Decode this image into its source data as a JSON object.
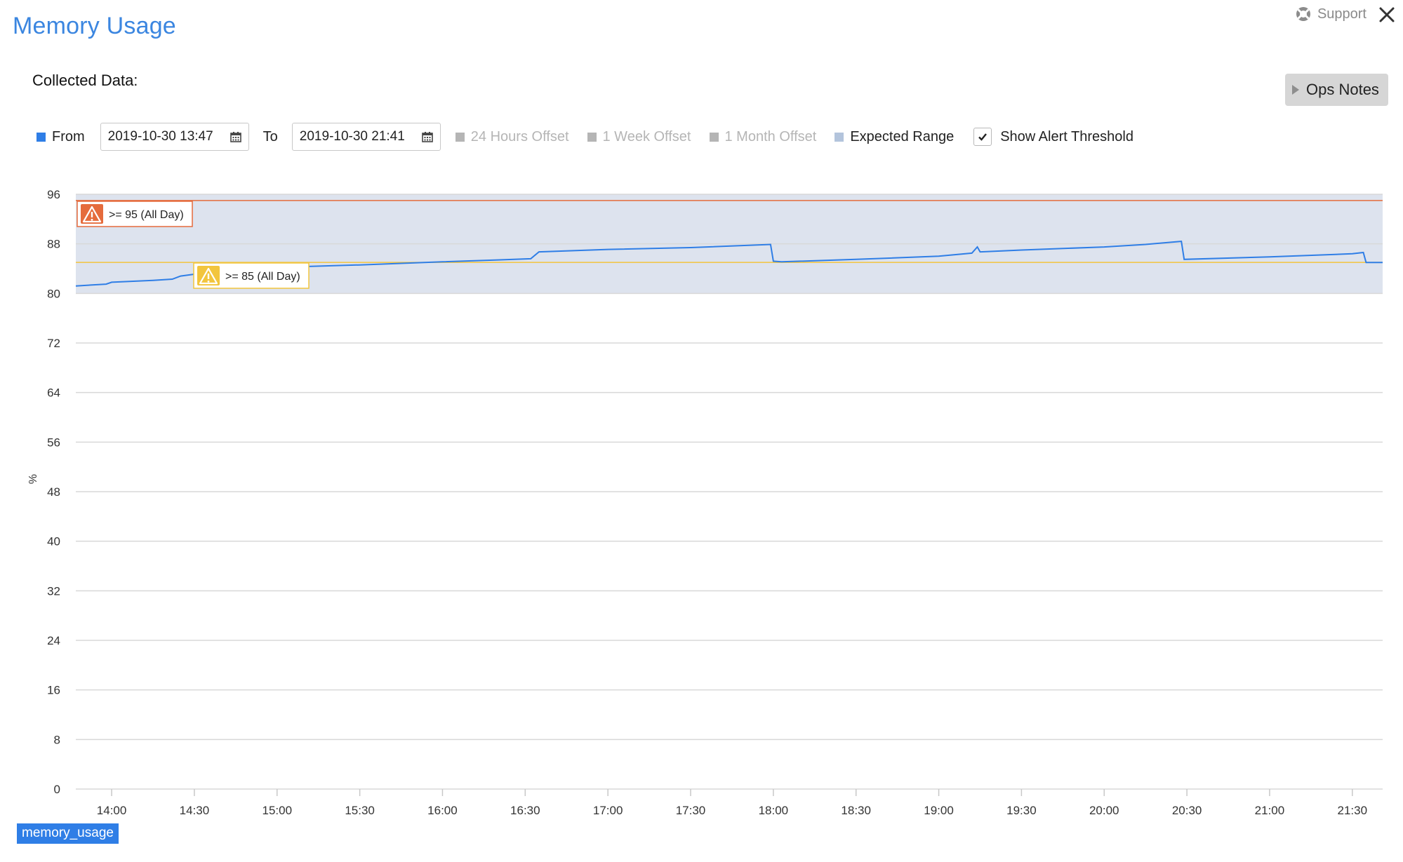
{
  "header": {
    "title": "Memory Usage",
    "support_label": "Support"
  },
  "collected_label": "Collected Data:",
  "ops_notes_label": "Ops Notes",
  "controls": {
    "from_label": "From",
    "from_value": "2019-10-30 13:47",
    "to_label": "To",
    "to_value": "2019-10-30 21:41",
    "offset_24h": "24 Hours Offset",
    "offset_week": "1 Week Offset",
    "offset_month": "1 Month Offset",
    "expected_range": "Expected Range",
    "show_alert": "Show Alert Threshold",
    "show_alert_checked": true
  },
  "colors": {
    "series": "#2f7ee6",
    "expected_range": "#dde3ee",
    "critical": "#e56b3c",
    "warning": "#f2c53d",
    "title": "#3b86e0"
  },
  "chart_data": {
    "type": "line",
    "ylabel": "%",
    "ylim": [
      0,
      96
    ],
    "y_ticks": [
      0,
      8,
      16,
      24,
      32,
      40,
      48,
      56,
      64,
      72,
      80,
      88,
      96
    ],
    "x_ticks": [
      "14:00",
      "14:30",
      "15:00",
      "15:30",
      "16:00",
      "16:30",
      "17:00",
      "17:30",
      "18:00",
      "18:30",
      "19:00",
      "19:30",
      "20:00",
      "20:30",
      "21:00",
      "21:30"
    ],
    "x_range": [
      "13:47",
      "21:41"
    ],
    "grid": true,
    "series": [
      {
        "name": "memory_usage",
        "x": [
          "13:47",
          "13:58",
          "14:00",
          "14:15",
          "14:22",
          "14:25",
          "14:35",
          "15:00",
          "15:30",
          "16:00",
          "16:20",
          "16:32",
          "16:35",
          "17:00",
          "17:30",
          "17:59",
          "18:00",
          "18:03",
          "18:30",
          "19:00",
          "19:12",
          "19:14",
          "19:15",
          "19:30",
          "20:00",
          "20:15",
          "20:28",
          "20:29",
          "21:00",
          "21:30",
          "21:34",
          "21:35",
          "21:41"
        ],
        "values": [
          81.2,
          81.5,
          81.8,
          82.1,
          82.3,
          82.8,
          83.4,
          84.2,
          84.6,
          85.1,
          85.4,
          85.6,
          86.7,
          87.1,
          87.4,
          87.9,
          85.2,
          85.1,
          85.5,
          86.0,
          86.5,
          87.5,
          86.7,
          87.0,
          87.5,
          87.9,
          88.4,
          85.5,
          85.9,
          86.4,
          86.6,
          85.0,
          85.0
        ]
      }
    ],
    "expected_range": [
      80,
      96
    ],
    "thresholds": [
      {
        "label": ">= 95 (All Day)",
        "value": 95,
        "severity": "critical"
      },
      {
        "label": ">= 85 (All Day)",
        "value": 85,
        "severity": "warning"
      }
    ]
  }
}
